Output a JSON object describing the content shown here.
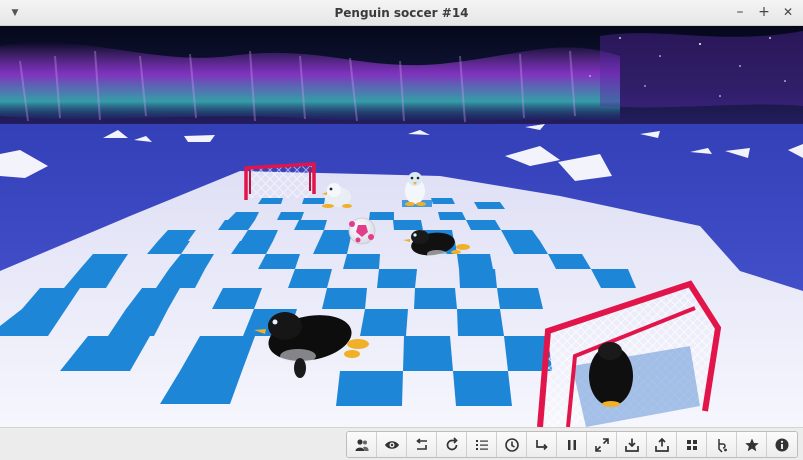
{
  "window": {
    "title": "Penguin soccer #14",
    "controls": [
      "minimize",
      "maximize",
      "close"
    ],
    "minimize_glyph": "–",
    "maximize_glyph": "+",
    "close_glyph": "✕",
    "menu_glyph": "▼"
  },
  "scene": {
    "description_icons": [
      "aurora-sky",
      "ice-floor",
      "checkered-field",
      "red-goal-left",
      "red-goal-right",
      "soccer-ball",
      "penguin"
    ],
    "colors": {
      "sky_top": "#06091a",
      "aurora_purple": "#8a2bd6",
      "aurora_teal": "#3fd0c9",
      "ocean": "#2f3fbe",
      "ice": "#f2f2fb",
      "tile_blue": "#1f87d8",
      "goal_red": "#e2154a",
      "ball_pink": "#e23d8b"
    }
  },
  "toolbar": {
    "buttons": [
      {
        "name": "players-button",
        "icon": "players-icon",
        "label": "Players"
      },
      {
        "name": "view-button",
        "icon": "eye-icon",
        "label": "View"
      },
      {
        "name": "undo-button",
        "icon": "undo-icon",
        "label": "Undo"
      },
      {
        "name": "restart-button",
        "icon": "restart-icon",
        "label": "Restart"
      },
      {
        "name": "moves-list-button",
        "icon": "list-icon",
        "label": "Moves"
      },
      {
        "name": "clock-button",
        "icon": "clock-icon",
        "label": "Clock"
      },
      {
        "name": "redo-button",
        "icon": "redo-icon",
        "label": "Redo"
      },
      {
        "name": "pause-button",
        "icon": "pause-icon",
        "label": "Pause"
      },
      {
        "name": "fullscreen-button",
        "icon": "fullscreen-icon",
        "label": "Fullscreen"
      },
      {
        "name": "load-button",
        "icon": "download-icon",
        "label": "Load"
      },
      {
        "name": "save-button",
        "icon": "upload-icon",
        "label": "Save"
      },
      {
        "name": "grid-button",
        "icon": "grid-icon",
        "label": "Grid"
      },
      {
        "name": "hint-button",
        "icon": "hint-icon",
        "label": "Hint"
      },
      {
        "name": "favorite-button",
        "icon": "star-icon",
        "label": "Favorite"
      },
      {
        "name": "info-button",
        "icon": "info-icon",
        "label": "Info"
      }
    ]
  }
}
